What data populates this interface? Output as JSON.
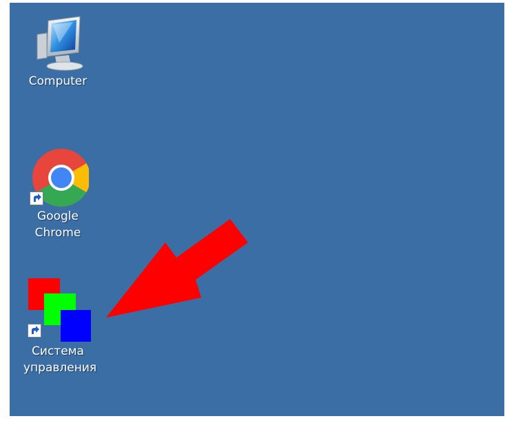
{
  "desktop": {
    "background": "#3b6ea5",
    "icons": [
      {
        "id": "computer",
        "label": "Computer",
        "icon": "monitor-icon"
      },
      {
        "id": "chrome",
        "label": "Google Chrome",
        "label_lines": [
          "Google",
          "Chrome"
        ],
        "icon": "chrome-icon",
        "shortcut": true
      },
      {
        "id": "control-system",
        "label": "Система управления",
        "label_lines": [
          "Система",
          "управления"
        ],
        "icon": "colored-squares-icon",
        "shortcut": true
      }
    ],
    "annotation": {
      "kind": "arrow",
      "color": "#ff0000",
      "points_to": "control-system"
    }
  }
}
